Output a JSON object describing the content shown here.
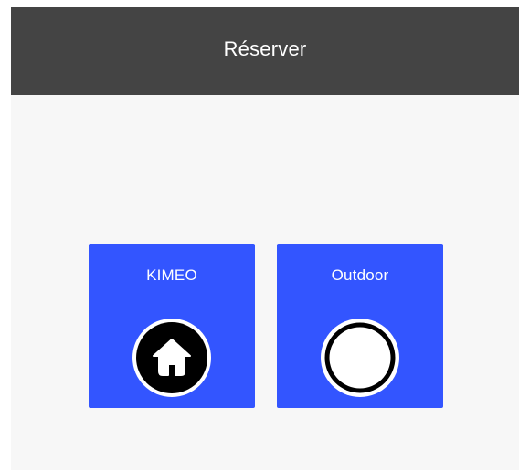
{
  "header": {
    "title": "Réserver"
  },
  "colors": {
    "header_bg": "#444444",
    "content_bg": "#f7f7f7",
    "tile_bg": "#3355ff",
    "text_light": "#ffffff",
    "icon_dark": "#000000"
  },
  "tiles": [
    {
      "label": "KIMEO",
      "icon": "home-icon"
    },
    {
      "label": "Outdoor",
      "icon": "empty-circle-icon"
    }
  ]
}
